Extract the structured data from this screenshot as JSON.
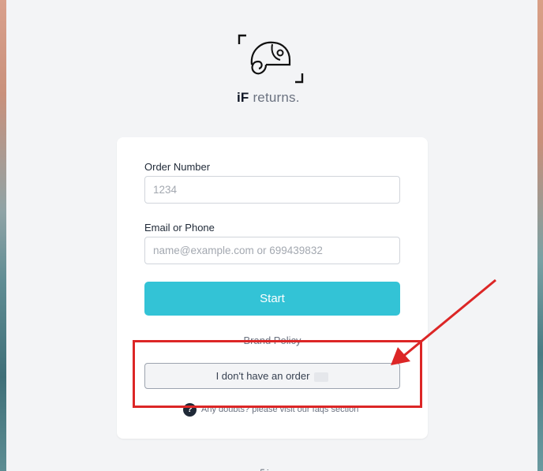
{
  "brand": {
    "prefix": "iF",
    "suffix": " returns."
  },
  "form": {
    "order_label": "Order Number",
    "order_placeholder": "1234",
    "contact_label": "Email or Phone",
    "contact_placeholder": "name@example.com or 699439832",
    "start_label": "Start",
    "policy_label": "Brand Policy",
    "no_order_label": "I don't have an order",
    "faq_text": "Any doubts? please visit our faqs section",
    "faq_icon_glyph": "?"
  },
  "colors": {
    "accent": "#33c3d6",
    "annotation": "#dc2626"
  },
  "icons": [
    "chameleon-logo-icon",
    "question-icon",
    "arrow-annotation-icon"
  ]
}
